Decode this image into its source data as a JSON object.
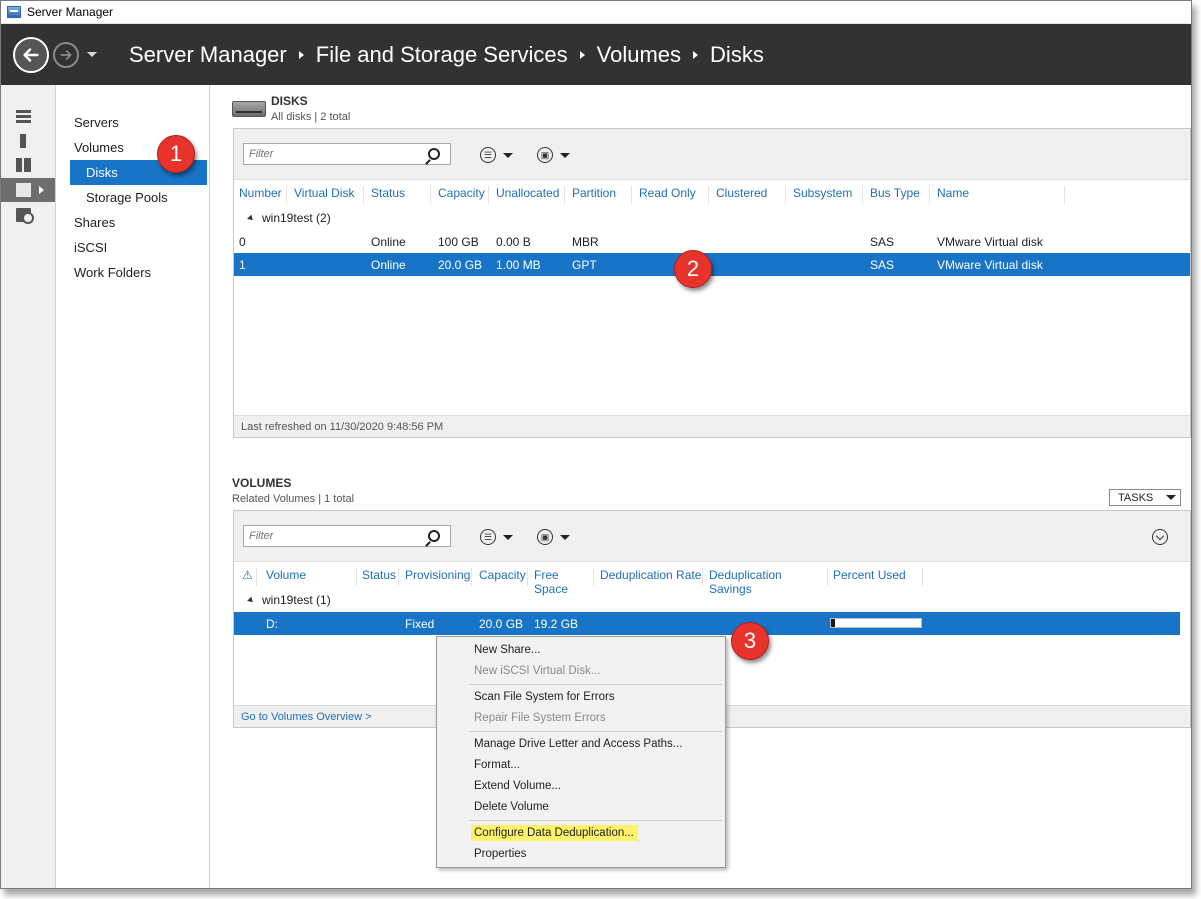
{
  "window": {
    "title": "Server Manager"
  },
  "breadcrumb": [
    "Server Manager",
    "File and Storage Services",
    "Volumes",
    "Disks"
  ],
  "subnav": {
    "items": [
      {
        "label": "Servers"
      },
      {
        "label": "Volumes"
      },
      {
        "label": "Disks"
      },
      {
        "label": "Storage Pools"
      },
      {
        "label": "Shares"
      },
      {
        "label": "iSCSI"
      },
      {
        "label": "Work Folders"
      }
    ]
  },
  "disks": {
    "title": "DISKS",
    "subtitle": "All disks | 2 total",
    "filter_placeholder": "Filter",
    "columns": [
      "Number",
      "Virtual Disk",
      "Status",
      "Capacity",
      "Unallocated",
      "Partition",
      "Read Only",
      "Clustered",
      "Subsystem",
      "Bus Type",
      "Name"
    ],
    "group": "win19test (2)",
    "rows": [
      {
        "number": "0",
        "status": "Online",
        "capacity": "100 GB",
        "unallocated": "0.00 B",
        "partition": "MBR",
        "bus_type": "SAS",
        "name": "VMware Virtual disk"
      },
      {
        "number": "1",
        "status": "Online",
        "capacity": "20.0 GB",
        "unallocated": "1.00 MB",
        "partition": "GPT",
        "bus_type": "SAS",
        "name": "VMware Virtual disk"
      }
    ],
    "footer": "Last refreshed on 11/30/2020 9:48:56 PM"
  },
  "volumes": {
    "title": "VOLUMES",
    "subtitle": "Related Volumes | 1 total",
    "tasks_label": "TASKS",
    "filter_placeholder": "Filter",
    "columns": [
      "Volume",
      "Status",
      "Provisioning",
      "Capacity",
      "Free Space",
      "Deduplication Rate",
      "Deduplication Savings",
      "Percent Used"
    ],
    "group": "win19test (1)",
    "rows": [
      {
        "volume": "D:",
        "provisioning": "Fixed",
        "capacity": "20.0 GB",
        "free_space": "19.2 GB",
        "percent_used": 0.04
      }
    ],
    "footer_link": "Go to Volumes Overview >"
  },
  "context_menu": {
    "items": [
      {
        "label": "New Share...",
        "disabled": false
      },
      {
        "label": "New iSCSI Virtual Disk...",
        "disabled": true
      },
      {
        "label": "Scan File System for Errors",
        "disabled": false
      },
      {
        "label": "Repair File System Errors",
        "disabled": true
      },
      {
        "label": "Manage Drive Letter and Access Paths...",
        "disabled": false
      },
      {
        "label": "Format...",
        "disabled": false
      },
      {
        "label": "Extend Volume...",
        "disabled": false
      },
      {
        "label": "Delete Volume",
        "disabled": false
      },
      {
        "label": "Configure Data Deduplication...",
        "disabled": false
      },
      {
        "label": "Properties",
        "disabled": false
      }
    ]
  },
  "callouts": [
    "1",
    "2",
    "3"
  ],
  "colors": {
    "selection": "#1874c7",
    "header_bg": "#323232",
    "callout": "#e8332d",
    "highlight": "#fdf36a"
  }
}
